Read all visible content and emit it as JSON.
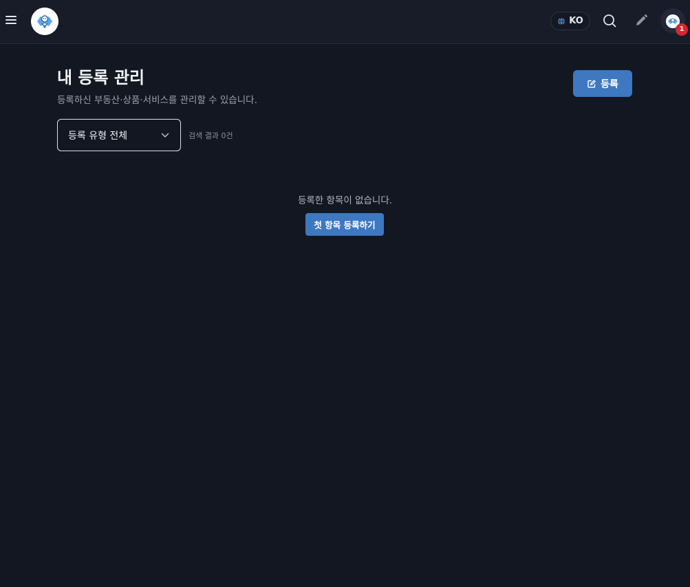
{
  "header": {
    "language_label": "KO",
    "notification_count": "1"
  },
  "main": {
    "title": "내 등록 관리",
    "subtitle": "등록하신 부동산·상품·서비스를 관리할 수 있습니다.",
    "register_button_label": "등록",
    "filter": {
      "selected": "등록 유형 전체"
    },
    "result_count": "검색 결과 0건",
    "empty_state": {
      "message": "등록한 항목이 없습니다.",
      "button_label": "첫 항목 등록하기"
    }
  },
  "colors": {
    "background": "#121722",
    "topbar": "#171c28",
    "accent": "#3d78c0",
    "badge": "#d7262f"
  },
  "icons": [
    "menu-icon",
    "logo-icon",
    "globe-icon",
    "search-icon",
    "pencil-icon",
    "avatar-icon",
    "edit-icon",
    "chevron-down-icon"
  ]
}
